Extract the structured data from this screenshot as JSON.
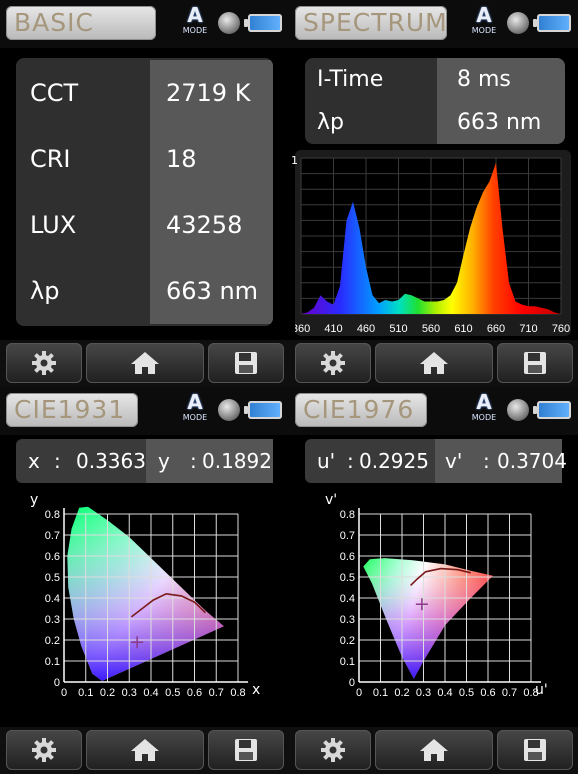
{
  "basic": {
    "tab_label": "BASIC",
    "mode_letter": "A",
    "mode_text": "MODE",
    "rows": [
      {
        "label": "CCT",
        "value": "2719 K"
      },
      {
        "label": "CRI",
        "value": "18"
      },
      {
        "label": "LUX",
        "value": "43258"
      },
      {
        "label": "λp",
        "value": "663 nm"
      }
    ]
  },
  "spectrum": {
    "tab_label": "SPECTRUM",
    "mode_letter": "A",
    "mode_text": "MODE",
    "itime_label": "I-Time",
    "itime_value": "8 ms",
    "peak_label": "λp",
    "peak_value": "663 nm",
    "y_tick_top": "1",
    "x_ticks": [
      "360",
      "410",
      "460",
      "510",
      "560",
      "610",
      "660",
      "710",
      "760"
    ]
  },
  "cie1931": {
    "tab_label": "CIE1931",
    "mode_letter": "A",
    "mode_text": "MODE",
    "x_key": "x",
    "x_sep": ":",
    "x_value": "0.3363",
    "y_key": "y",
    "y_sep": ":",
    "y_value": "0.1892",
    "axis_x_label": "x",
    "axis_y_label": "y",
    "x_ticks": [
      "0",
      "0.1",
      "0.2",
      "0.3",
      "0.4",
      "0.5",
      "0.6",
      "0.7",
      "0.8"
    ],
    "y_ticks": [
      "0",
      "0.1",
      "0.2",
      "0.3",
      "0.4",
      "0.5",
      "0.6",
      "0.7",
      "0.8"
    ]
  },
  "cie1976": {
    "tab_label": "CIE1976",
    "mode_letter": "A",
    "mode_text": "MODE",
    "u_key": "u'",
    "u_sep": ":",
    "u_value": "0.2925",
    "v_key": "v'",
    "v_sep": ":",
    "v_value": "0.3704",
    "axis_x_label": "u'",
    "axis_y_label": "v'",
    "x_ticks": [
      "0",
      "0.1",
      "0.2",
      "0.3",
      "0.4",
      "0.5",
      "0.6",
      "0.7",
      "0.8"
    ],
    "y_ticks": [
      "0",
      "0.1",
      "0.2",
      "0.3",
      "0.4",
      "0.5",
      "0.6",
      "0.7",
      "0.8"
    ]
  },
  "chart_data": [
    {
      "type": "area",
      "title": "",
      "xlabel": "",
      "ylabel": "",
      "xlim": [
        360,
        760
      ],
      "ylim": [
        0,
        1
      ],
      "x": [
        360,
        370,
        380,
        390,
        400,
        410,
        420,
        430,
        440,
        450,
        460,
        470,
        480,
        490,
        500,
        510,
        520,
        530,
        540,
        550,
        560,
        570,
        580,
        590,
        600,
        610,
        620,
        630,
        640,
        650,
        660,
        670,
        680,
        690,
        700,
        710,
        720,
        730,
        740,
        750,
        760
      ],
      "series": [
        {
          "values": [
            0,
            0.01,
            0.04,
            0.12,
            0.08,
            0.06,
            0.18,
            0.6,
            0.72,
            0.55,
            0.3,
            0.12,
            0.07,
            0.09,
            0.08,
            0.09,
            0.13,
            0.12,
            0.1,
            0.08,
            0.08,
            0.08,
            0.09,
            0.12,
            0.2,
            0.38,
            0.55,
            0.68,
            0.78,
            0.85,
            0.97,
            0.55,
            0.2,
            0.08,
            0.06,
            0.05,
            0.05,
            0.04,
            0.03,
            0.01,
            0
          ]
        }
      ]
    },
    {
      "type": "scatter",
      "title": "",
      "xlabel": "x",
      "ylabel": "y",
      "xlim": [
        0,
        0.8
      ],
      "ylim": [
        0,
        0.9
      ],
      "series": [
        {
          "x": [
            0.3363
          ],
          "y": [
            0.1892
          ]
        }
      ]
    },
    {
      "type": "scatter",
      "title": "",
      "xlabel": "u'",
      "ylabel": "v'",
      "xlim": [
        0,
        0.8
      ],
      "ylim": [
        0,
        0.8
      ],
      "series": [
        {
          "x": [
            0.2925
          ],
          "y": [
            0.3704
          ]
        }
      ]
    }
  ]
}
